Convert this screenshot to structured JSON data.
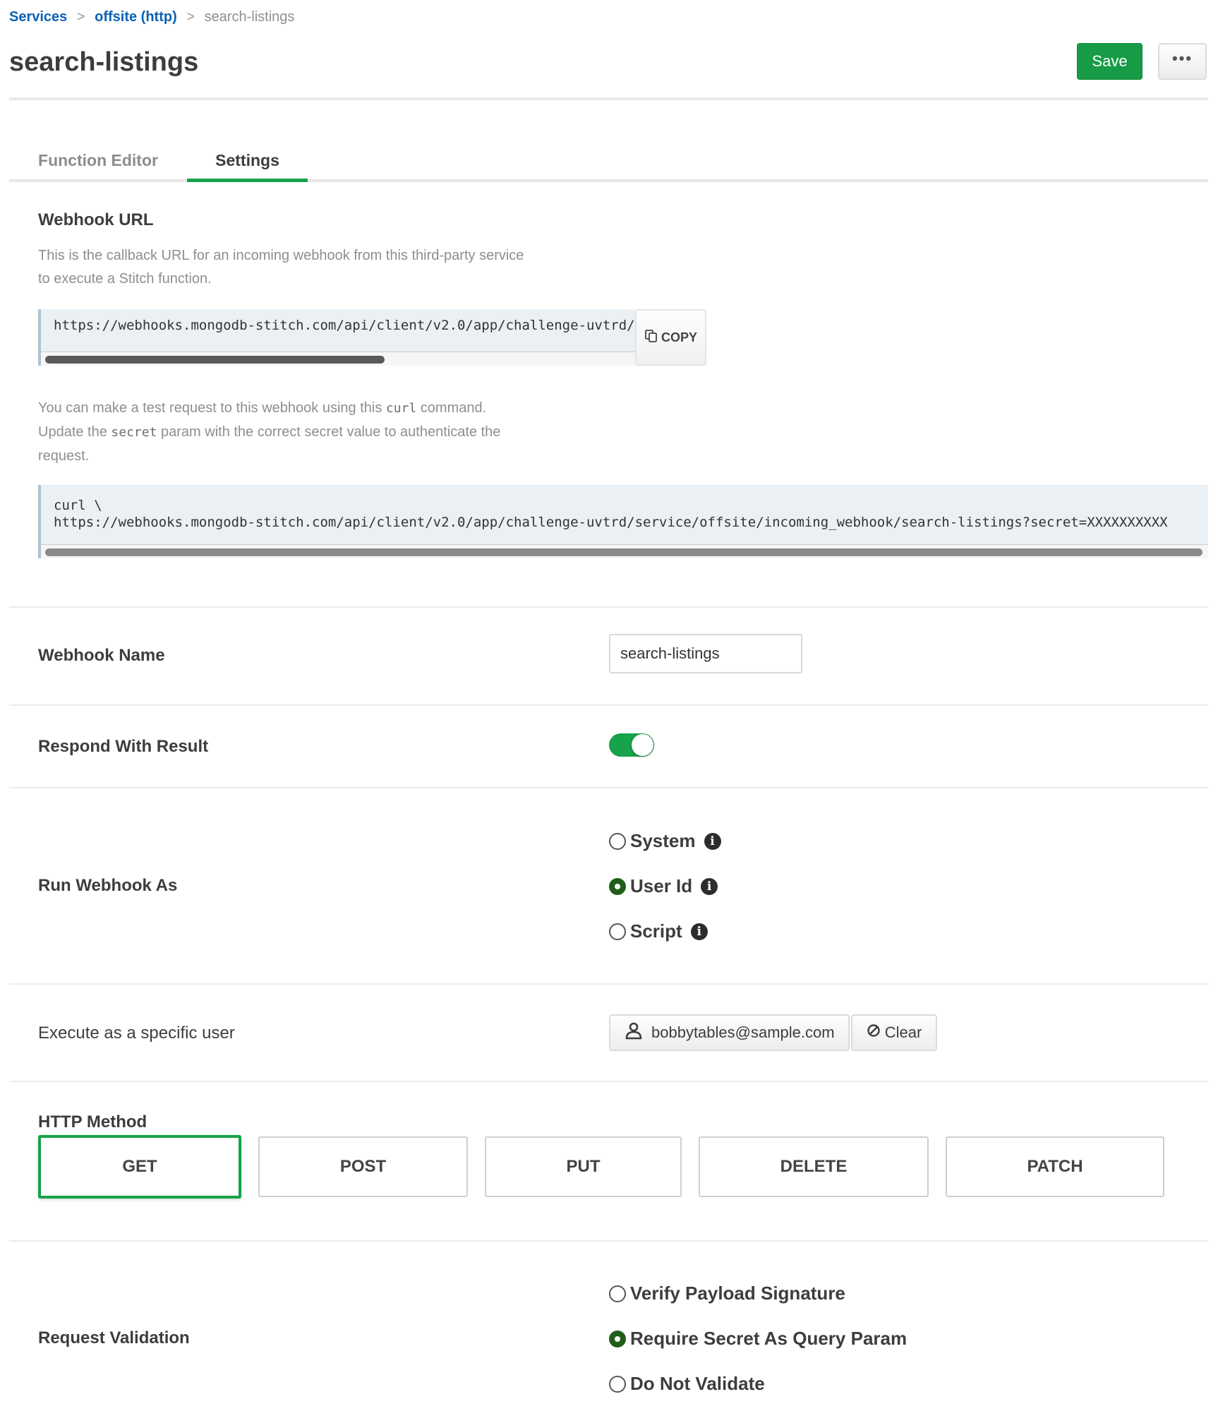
{
  "breadcrumb": {
    "items": [
      "Services",
      "offsite (http)"
    ],
    "separator": ">",
    "current": "search-listings"
  },
  "header": {
    "title": "search-listings",
    "save_label": "Save",
    "more_label": "•••"
  },
  "tabs": [
    {
      "label": "Function Editor",
      "active": false
    },
    {
      "label": "Settings",
      "active": true
    }
  ],
  "webhook_url": {
    "title": "Webhook URL",
    "description_line1": "This is the callback URL for an incoming webhook from this third-party service",
    "description_line2": "to execute a Stitch function.",
    "url": "https://webhooks.mongodb-stitch.com/api/client/v2.0/app/challenge-uvtrd/service/offsite/incoming_webhook/search-listings",
    "copy_label": "COPY",
    "scroll_visible_fraction": 0.58
  },
  "curl": {
    "desc_part1": "You can make a test request to this webhook using this ",
    "desc_code1": "curl",
    "desc_part2": " command.",
    "desc_part3": "Update the ",
    "desc_code2": "secret",
    "desc_part4": " param with the correct secret value to authenticate the",
    "desc_part5": "request.",
    "line1": "curl \\",
    "line2": "https://webhooks.mongodb-stitch.com/api/client/v2.0/app/challenge-uvtrd/service/offsite/incoming_webhook/search-listings?secret=XXXXXXXXXX"
  },
  "webhook_name": {
    "label": "Webhook Name",
    "value": "search-listings"
  },
  "respond_with_result": {
    "label": "Respond With Result",
    "enabled": true
  },
  "run_webhook_as": {
    "label": "Run Webhook As",
    "options": [
      {
        "label": "System",
        "checked": false
      },
      {
        "label": "User Id",
        "checked": true
      },
      {
        "label": "Script",
        "checked": false
      }
    ]
  },
  "execute_as_user": {
    "label": "Execute as a specific user",
    "user": "bobbytables@sample.com",
    "clear_label": "Clear"
  },
  "http_method": {
    "label": "HTTP Method",
    "methods": [
      "GET",
      "POST",
      "PUT",
      "DELETE",
      "PATCH"
    ],
    "selected": "GET"
  },
  "request_validation": {
    "label": "Request Validation",
    "options": [
      {
        "label": "Verify Payload Signature",
        "checked": false
      },
      {
        "label": "Require Secret As Query Param",
        "checked": true
      },
      {
        "label": "Do Not Validate",
        "checked": false
      }
    ]
  },
  "colors": {
    "accent": "#16a34a",
    "link": "#0b62b6",
    "radio_checked": "#1e5e18"
  }
}
